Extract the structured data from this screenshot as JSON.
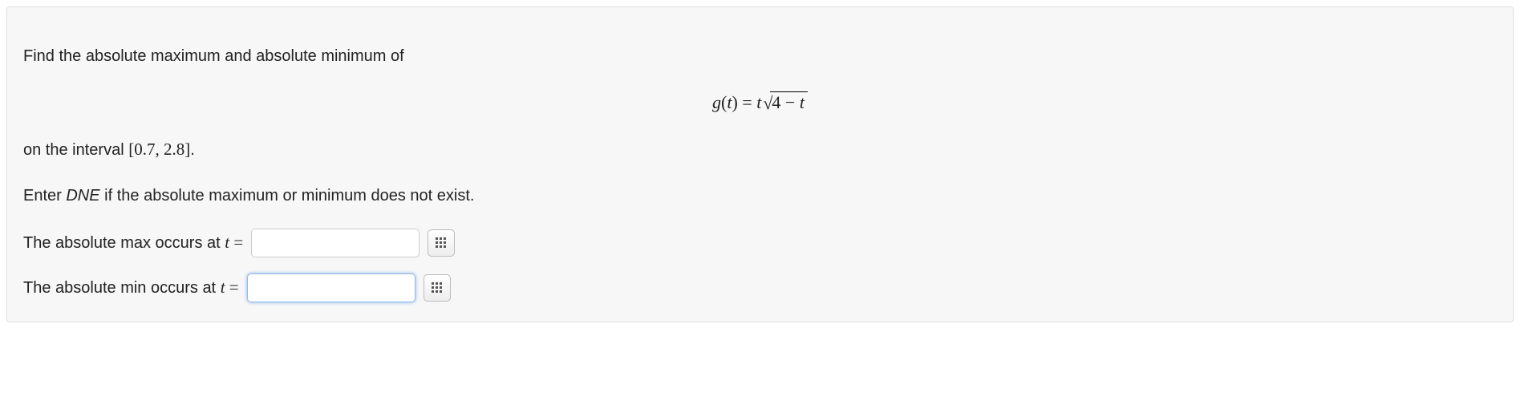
{
  "problem": {
    "intro": "Find the absolute maximum and absolute minimum of",
    "equation": {
      "lhs_fn": "g",
      "lhs_paren_open": "(",
      "lhs_var": "t",
      "lhs_paren_close": ")",
      "equals": " = ",
      "rhs_var": "t",
      "sqrt_symbol": "√",
      "radicand_num": "4",
      "radicand_op": " − ",
      "radicand_var": "t"
    },
    "interval_prefix": "on the interval ",
    "interval": "[0.7, 2.8]",
    "interval_suffix": ".",
    "dne_pre": "Enter ",
    "dne_word": "DNE",
    "dne_post": " if the absolute maximum or minimum does not exist.",
    "answers": {
      "max": {
        "label_pre": "The absolute max occurs at ",
        "var": "t",
        "equals": " = ",
        "value": "",
        "placeholder": ""
      },
      "min": {
        "label_pre": "The absolute min occurs at ",
        "var": "t",
        "equals": " = ",
        "value": "",
        "placeholder": ""
      }
    }
  },
  "icons": {
    "grid": "grid-icon"
  }
}
